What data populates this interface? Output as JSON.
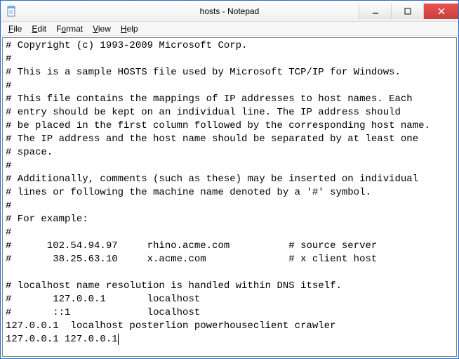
{
  "window": {
    "title": "hosts - Notepad"
  },
  "menu": {
    "file": "File",
    "edit": "Edit",
    "format": "Format",
    "view": "View",
    "help": "Help"
  },
  "content": {
    "lines": [
      "# Copyright (c) 1993-2009 Microsoft Corp.",
      "#",
      "# This is a sample HOSTS file used by Microsoft TCP/IP for Windows.",
      "#",
      "# This file contains the mappings of IP addresses to host names. Each",
      "# entry should be kept on an individual line. The IP address should",
      "# be placed in the first column followed by the corresponding host name.",
      "# The IP address and the host name should be separated by at least one",
      "# space.",
      "#",
      "# Additionally, comments (such as these) may be inserted on individual",
      "# lines or following the machine name denoted by a '#' symbol.",
      "#",
      "# For example:",
      "#",
      "#      102.54.94.97     rhino.acme.com          # source server",
      "#       38.25.63.10     x.acme.com              # x client host",
      "",
      "# localhost name resolution is handled within DNS itself.",
      "#       127.0.0.1       localhost",
      "#       ::1             localhost",
      "127.0.0.1  localhost posterlion powerhouseclient crawler",
      "127.0.0.1 127.0.0.1"
    ]
  }
}
